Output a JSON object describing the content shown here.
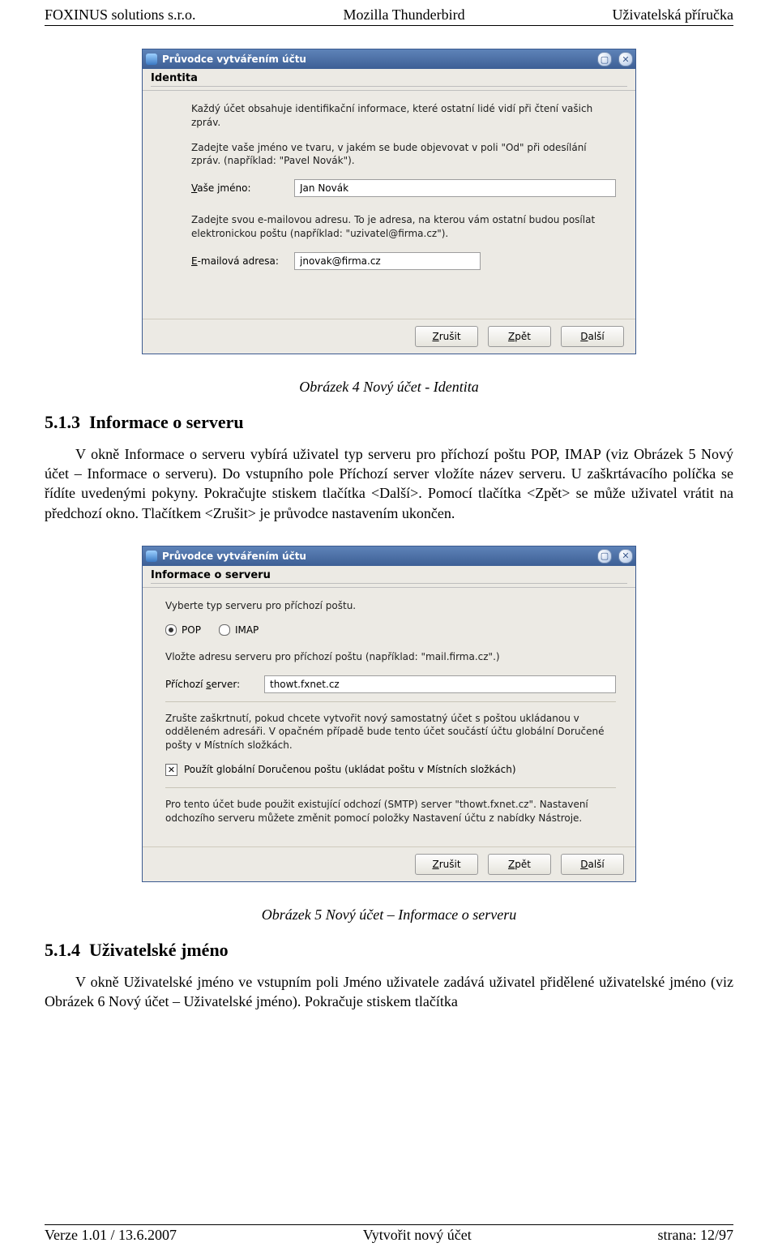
{
  "header": {
    "left": "FOXINUS solutions s.r.o.",
    "center": "Mozilla Thunderbird",
    "right": "Uživatelská příručka"
  },
  "footer": {
    "left": "Verze 1.01 / 13.6.2007",
    "center": "Vytvořit nový účet",
    "right": "strana: 12/97"
  },
  "caption1": "Obrázek 4 Nový účet - Identita",
  "section513": {
    "num": "5.1.3",
    "title": "Informace o serveru"
  },
  "para513": "V okně Informace o serveru vybírá uživatel typ serveru pro příchozí poštu POP, IMAP (viz Obrázek 5 Nový účet – Informace o serveru). Do vstupního pole Příchozí server vložíte název serveru. U zaškrtávacího políčka se řídíte uvedenými pokyny. Pokračujte stiskem tlačítka <Další>. Pomocí tlačítka <Zpět> se může uživatel vrátit na předchozí okno. Tlačítkem <Zrušit> je průvodce nastavením ukončen.",
  "caption2": "Obrázek 5 Nový účet – Informace o serveru",
  "section514": {
    "num": "5.1.4",
    "title": "Uživatelské jméno"
  },
  "para514": "V okně Uživatelské jméno ve vstupním poli Jméno uživatele zadává uživatel přidělené uživatelské jméno (viz Obrázek 6 Nový účet – Uživatelské jméno). Pokračuje stiskem tlačítka",
  "dlg": {
    "title": "Průvodce vytvářením účtu",
    "buttons": {
      "cancel": "Zrušit",
      "back": "Zpět",
      "next": "Další"
    }
  },
  "identity": {
    "section": "Identita",
    "intro": "Každý účet obsahuje identifikační informace, které ostatní lidé vidí při čtení vašich zpráv.",
    "name_prompt": "Zadejte vaše jméno ve tvaru, v jakém se bude objevovat v poli \"Od\" při odesílání zpráv. (například: \"Pavel Novák\").",
    "name_label": "Vaše jméno:",
    "name_value": "Jan Novák",
    "email_prompt": "Zadejte svou e-mailovou adresu. To je adresa, na kterou vám ostatní budou posílat elektronickou poštu (například: \"uzivatel@firma.cz\").",
    "email_label": "E-mailová adresa:",
    "email_value": "jnovak@firma.cz"
  },
  "server": {
    "section": "Informace o serveru",
    "choose": "Vyberte typ serveru pro příchozí poštu.",
    "pop": "POP",
    "imap": "IMAP",
    "incoming_prompt": "Vložte adresu serveru pro příchozí poštu (například: \"mail.firma.cz\".)",
    "incoming_label": "Příchozí server:",
    "incoming_value": "thowt.fxnet.cz",
    "global_text": "Zrušte zaškrtnutí, pokud chcete vytvořit nový samostatný účet s poštou ukládanou v odděleném adresáři. V opačném případě bude tento účet součástí účtu globální Doručené pošty v Místních složkách.",
    "global_check": "Použít globální Doručenou poštu (ukládat poštu v Místních složkách)",
    "smtp_text1": "Pro tento účet bude použit existující odchozí (SMTP) server \"thowt.fxnet.cz\". Nastavení odchozího serveru můžete změnit pomocí položky Nastavení účtu z nabídky Nástroje."
  }
}
